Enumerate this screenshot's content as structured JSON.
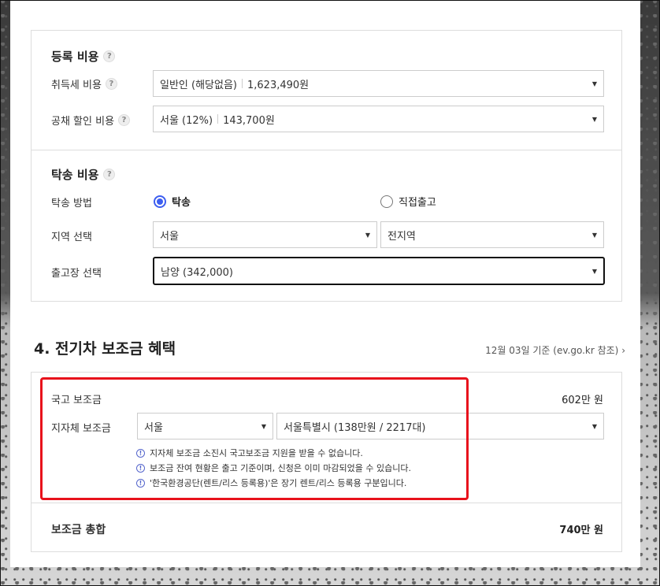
{
  "registration": {
    "title": "등록 비용",
    "acquisition_tax": {
      "label": "취득세 비용",
      "option": "일반인 (해당없음)",
      "amount": "1,623,490원"
    },
    "bond_discount": {
      "label": "공채 할인 비용",
      "option": "서울 (12%)",
      "amount": "143,700원"
    }
  },
  "delivery": {
    "title": "탁송 비용",
    "method_label": "탁송 방법",
    "method_options": [
      "탁송",
      "직접출고"
    ],
    "method_selected": "탁송",
    "region_label": "지역 선택",
    "region_city": "서울",
    "region_area": "전지역",
    "release_label": "출고장 선택",
    "release_value": "남양 (342,000)"
  },
  "subsidy": {
    "heading": "4. 전기차 보조금 혜택",
    "reference": "12월 03일 기준 (ev.go.kr 참조)",
    "national_label": "국고 보조금",
    "national_amount": "602만 원",
    "local_label": "지자체 보조금",
    "local_city": "서울",
    "local_detail": "서울특별시 (138만원 / 2217대)",
    "notes": [
      "지자체 보조금 소진시 국고보조금 지원을 받을 수 없습니다.",
      "보조금 잔여 현황은 출고 기준이며, 신청은 이미 마감되었을 수 있습니다.",
      "'한국환경공단(렌트/리스 등록용)'은 장기 렌트/리스 등록용 구분입니다."
    ],
    "total_label": "보조금 총합",
    "total_amount": "740만 원"
  },
  "icons": {
    "help": "?",
    "info": "!",
    "arrow": "▼",
    "chevron": "›"
  }
}
